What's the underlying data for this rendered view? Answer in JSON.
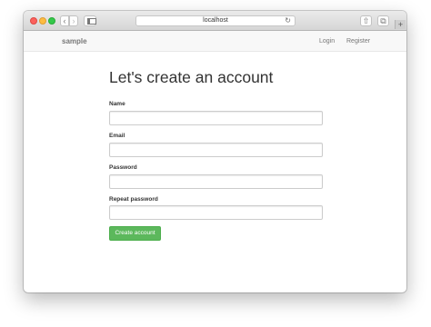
{
  "browser": {
    "url": "localhost",
    "nav_back_glyph": "‹",
    "nav_forward_glyph": "›",
    "reload_glyph": "↻",
    "share_glyph": "⇧",
    "tabs_glyph": "⧉",
    "new_tab_glyph": "+"
  },
  "navbar": {
    "brand": "sample",
    "links": [
      {
        "label": "Login"
      },
      {
        "label": "Register"
      }
    ]
  },
  "form": {
    "heading": "Let's create an account",
    "fields": [
      {
        "label": "Name",
        "value": "",
        "type": "text"
      },
      {
        "label": "Email",
        "value": "",
        "type": "email"
      },
      {
        "label": "Password",
        "value": "",
        "type": "password"
      },
      {
        "label": "Repeat password",
        "value": "",
        "type": "password"
      }
    ],
    "submit_label": "Create account"
  },
  "colors": {
    "submit_button": "#5cb85c",
    "navbar_background": "#f8f8f8",
    "heading_text": "#333333"
  }
}
